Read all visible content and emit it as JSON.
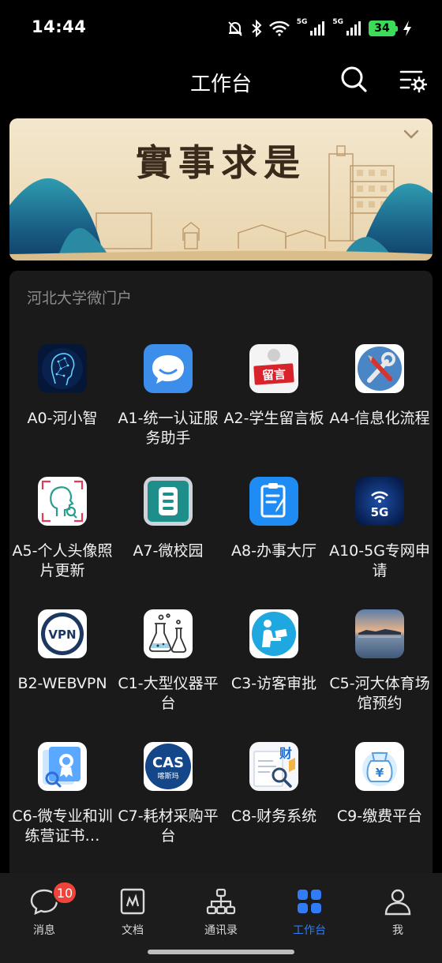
{
  "status_bar": {
    "time": "14:44",
    "network_1": "5G",
    "network_2": "5G",
    "battery": "34",
    "icons": [
      "bell-muted-icon",
      "bluetooth-icon",
      "wifi-icon",
      "signal-icon",
      "signal-icon",
      "battery-icon",
      "charging-icon"
    ]
  },
  "header": {
    "title": "工作台",
    "icons": [
      "search-icon",
      "settings-list-icon"
    ]
  },
  "banner": {
    "calligraphy": "實事求是",
    "colors": {
      "sky": "#efe1c4",
      "mountain": "#1f6f8b",
      "ink": "#3a2a1c"
    }
  },
  "portal": {
    "title": "河北大学微门户",
    "apps": [
      {
        "label": "A0-河小智",
        "icon": "ai-head-icon"
      },
      {
        "label": "A1-统一认证服务助手",
        "icon": "chat-bubble-icon"
      },
      {
        "label": "A2-学生留言板",
        "icon": "message-board-icon",
        "icon_text": "留言"
      },
      {
        "label": "A4-信息化流程",
        "icon": "tools-icon"
      },
      {
        "label": "A5-个人头像照片更新",
        "icon": "face-scan-icon"
      },
      {
        "label": "A7-微校园",
        "icon": "campus-card-icon"
      },
      {
        "label": "A8-办事大厅",
        "icon": "clipboard-icon"
      },
      {
        "label": "A10-5G专网申请",
        "icon": "5g-signal-icon",
        "icon_text": "5G"
      },
      {
        "label": "B2-WEBVPN",
        "icon": "vpn-icon",
        "icon_text": "VPN"
      },
      {
        "label": "C1-大型仪器平台",
        "icon": "lab-flask-icon"
      },
      {
        "label": "C3-访客审批",
        "icon": "visitor-icon"
      },
      {
        "label": "C5-河大体育场馆预约",
        "icon": "stadium-photo-icon"
      },
      {
        "label": "C6-微专业和训练营证书…",
        "icon": "certificate-icon"
      },
      {
        "label": "C7-耗材采购平台",
        "icon": "cas-logo-icon",
        "icon_text": "CAS",
        "icon_subtext": "喀斯玛"
      },
      {
        "label": "C8-财务系统",
        "icon": "finance-icon",
        "icon_text": "财"
      },
      {
        "label": "C9-缴费平台",
        "icon": "payment-bag-icon",
        "icon_text": "¥"
      }
    ]
  },
  "tab_bar": {
    "active_color": "#2f7cf6",
    "tabs": [
      {
        "label": "消息",
        "icon": "chat-icon",
        "badge": "10",
        "active": false
      },
      {
        "label": "文档",
        "icon": "document-icon",
        "active": false
      },
      {
        "label": "通讯录",
        "icon": "org-chart-icon",
        "active": false
      },
      {
        "label": "工作台",
        "icon": "grid-icon",
        "active": true
      },
      {
        "label": "我",
        "icon": "person-icon",
        "active": false
      }
    ]
  }
}
